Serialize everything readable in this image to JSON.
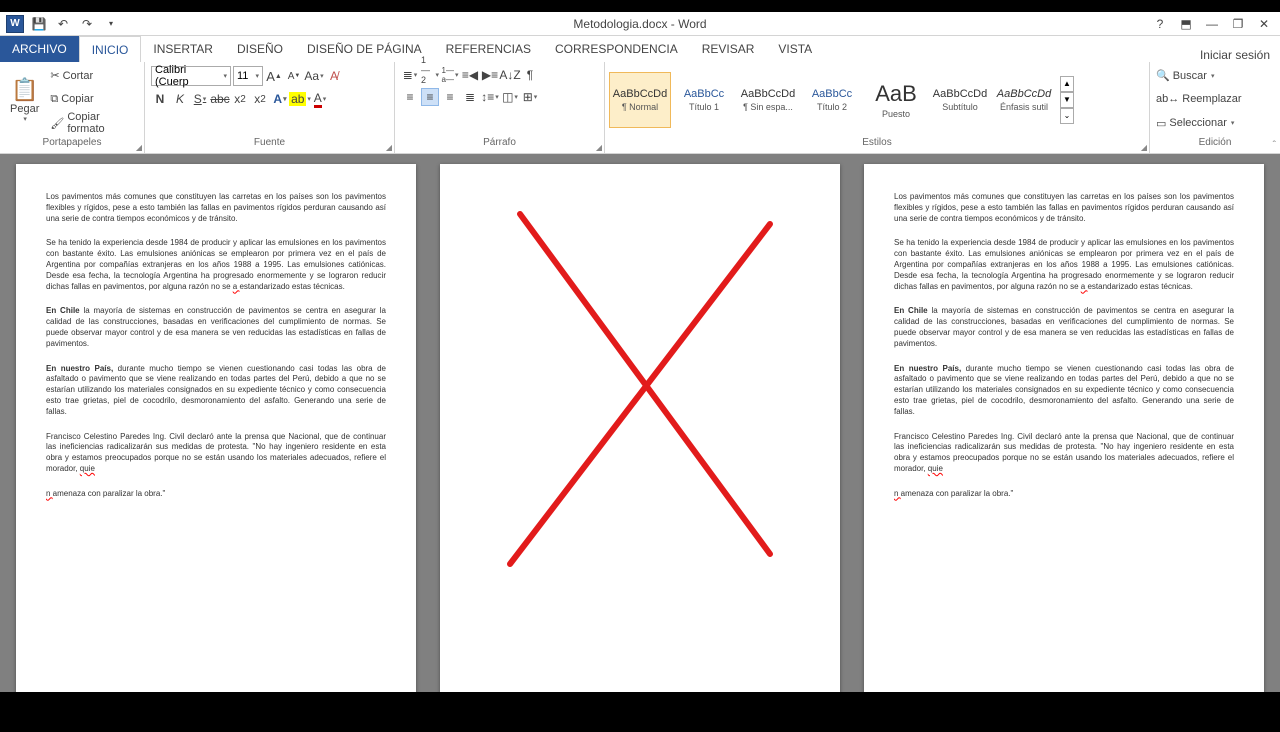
{
  "title": "Metodologia.docx - Word",
  "login": "Iniciar sesión",
  "tabs": {
    "file": "ARCHIVO",
    "home": "INICIO",
    "insert": "INSERTAR",
    "design": "DISEÑO",
    "pagelayout": "DISEÑO DE PÁGINA",
    "references": "REFERENCIAS",
    "mailings": "CORRESPONDENCIA",
    "review": "REVISAR",
    "view": "VISTA"
  },
  "groups": {
    "clipboard": "Portapapeles",
    "font": "Fuente",
    "paragraph": "Párrafo",
    "styles": "Estilos",
    "editing": "Edición"
  },
  "clipboard": {
    "paste": "Pegar",
    "cut": "Cortar",
    "copy": "Copiar",
    "format": "Copiar formato"
  },
  "font": {
    "name": "Calibri (Cuerp",
    "size": "11",
    "arrow": "▾"
  },
  "styles": [
    {
      "preview": "AaBbCcDd",
      "name": "¶ Normal",
      "cls": "",
      "sel": true
    },
    {
      "preview": "AaBbCc",
      "name": "Título 1",
      "cls": "blue"
    },
    {
      "preview": "AaBbCcDd",
      "name": "¶ Sin espa...",
      "cls": ""
    },
    {
      "preview": "AaBbCc",
      "name": "Título 2",
      "cls": "blue"
    },
    {
      "preview": "AaB",
      "name": "Puesto",
      "cls": "big"
    },
    {
      "preview": "AaBbCcDd",
      "name": "Subtítulo",
      "cls": ""
    },
    {
      "preview": "AaBbCcDd",
      "name": "Énfasis sutil",
      "cls": "italic"
    }
  ],
  "editing": {
    "find": "Buscar",
    "replace": "Reemplazar",
    "select": "Seleccionar"
  },
  "doc": {
    "p1": "Los pavimentos más comunes que constituyen las carretas en los países son los pavimentos flexibles y rígidos, pese a esto también las fallas en pavimentos rígidos perduran causando así una serie de contra tiempos económicos y de tránsito.",
    "p2a": "Se ha tenido la experiencia desde 1984 de producir y aplicar las emulsiones en los pavimentos con bastante éxito.  Las emulsiones aniónicas se emplearon por primera vez en el país de Argentina por compañías extranjeras en los años 1988 a 1995. Las emulsiones catiónicas. Desde esa fecha, la tecnología Argentina ha progresado enormemente y se lograron reducir dichas fallas en pavimentos, por alguna razón no se ",
    "p2b": "a ",
    "p2c": "estandarizado estas técnicas.",
    "p3a": "En Chile",
    "p3b": " la mayoría de sistemas en construcción de pavimentos se centra en asegurar la calidad de las construcciones, basadas en verificaciones del cumplimiento de normas. Se puede observar mayor control y de esa manera se ven reducidas las estadísticas en fallas de pavimentos.",
    "p4a": "En nuestro País,",
    "p4b": " durante mucho tiempo se vienen cuestionando casi todas las  obra de asfaltado o pavimento que se viene realizando en todas partes del Perú, debido a que no se estarían utilizando los materiales consignados en su expediente técnico y como consecuencia esto trae grietas, piel de cocodrilo, desmoronamiento del asfalto. Generando una serie de fallas.",
    "p5a": "Francisco Celestino Paredes Ing. Civil declaró ante la prensa que Nacional,  que de continuar las ineficiencias radicalizarán sus medidas de protesta. \"No hay ingeniero residente en esta obra y estamos preocupados porque no se están usando los materiales adecuados, refiere el morador, ",
    "p5b": "quie",
    "p6a": "n ",
    "p6b": "amenaza con paralizar la obra.\""
  }
}
